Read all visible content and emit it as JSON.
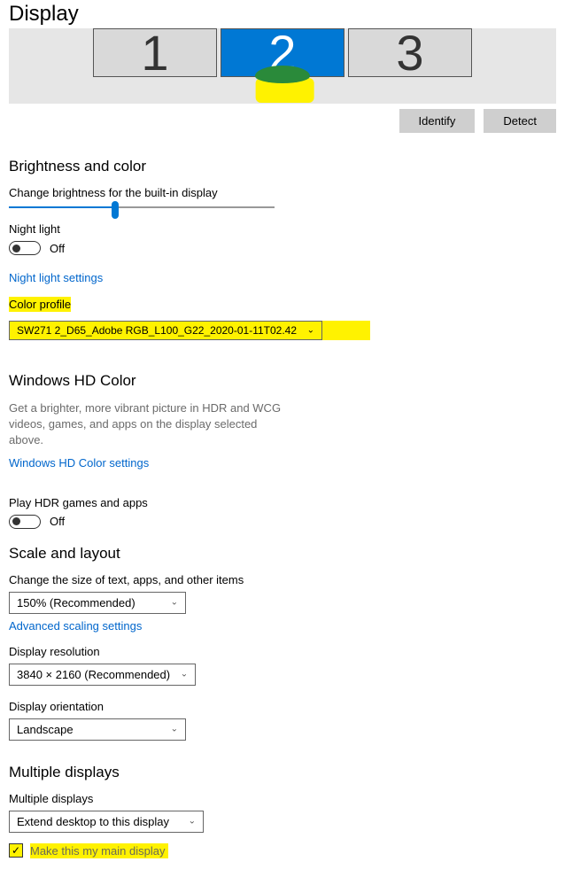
{
  "page": {
    "title": "Display"
  },
  "monitors": {
    "items": [
      {
        "label": "1",
        "selected": false
      },
      {
        "label": "2",
        "selected": true
      },
      {
        "label": "3",
        "selected": false
      }
    ]
  },
  "buttons": {
    "identify": "Identify",
    "detect": "Detect"
  },
  "sections": {
    "brightness": {
      "title": "Brightness and color",
      "slider_label": "Change brightness for the built-in display",
      "slider_percent": 40,
      "night_light_label": "Night light",
      "night_light_state": "Off",
      "night_light_link": "Night light settings",
      "color_profile_label": "Color profile",
      "color_profile_value": "SW271 2_D65_Adobe RGB_L100_G22_2020-01-11T02.42"
    },
    "hdcolor": {
      "title": "Windows HD Color",
      "description": "Get a brighter, more vibrant picture in HDR and WCG videos, games, and apps on the display selected above.",
      "link": "Windows HD Color settings",
      "hdr_label": "Play HDR games and apps",
      "hdr_state": "Off"
    },
    "scale": {
      "title": "Scale and layout",
      "size_label": "Change the size of text, apps, and other items",
      "size_value": "150% (Recommended)",
      "advanced_link": "Advanced scaling settings",
      "resolution_label": "Display resolution",
      "resolution_value": "3840 × 2160 (Recommended)",
      "orientation_label": "Display orientation",
      "orientation_value": "Landscape"
    },
    "multiple": {
      "title": "Multiple displays",
      "label": "Multiple displays",
      "value": "Extend desktop to this display",
      "main_display_label": "Make this my main display",
      "main_display_checked": true
    }
  }
}
